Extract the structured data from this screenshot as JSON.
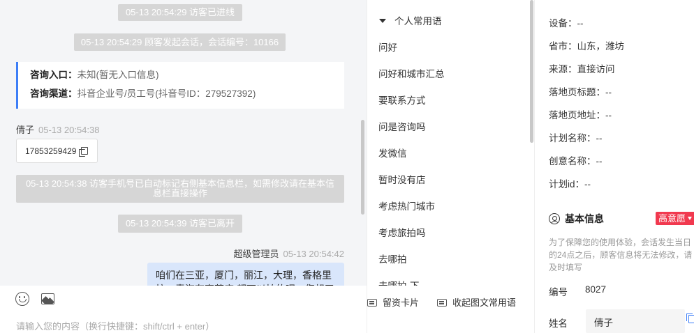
{
  "chat": {
    "sys_entered": "05-13 20:54:29 访客已进线",
    "sys_started": "05-13 20:54:29 顾客发起会话，会话编号：10166",
    "info_card": {
      "entry_label": "咨询入口：",
      "entry_value": "未知(暂无入口信息)",
      "channel_label": "咨询渠道：",
      "channel_value": "抖音企业号/员工号(抖音号ID：279527392)"
    },
    "visitor": {
      "name": "倩子",
      "time": "05-13 20:54:38"
    },
    "phone": "17853259429",
    "sys_phone_marked": "05-13 20:54:38 访客手机号已自动标记右侧基本信息栏，如需修改请在基本信息栏直接操作",
    "sys_left": "05-13 20:54:39 访客已离开",
    "agent": {
      "name": "超级管理员",
      "time": "05-13 20:54:42"
    },
    "agent_message": "咱们在三亚，厦门，丽江，大理，香格里拉，青海有直营店 都可以拍的呢，您想了解"
  },
  "composer": {
    "placeholder": "请输入您的内容（换行快捷键：shift/ctrl + enter）",
    "card_label": "留资卡片",
    "phrases_label": "收起图文常用语"
  },
  "phrases": {
    "group": "个人常用语",
    "items": [
      "问好",
      "问好和城市汇总",
      "要联系方式",
      "问是咨询吗",
      "发微信",
      "暂时没有店",
      "考虑热门城市",
      "考虑旅拍吗",
      "去哪拍",
      "去哪拍-下"
    ]
  },
  "info": {
    "device_label": "设备：",
    "device_value": "--",
    "province_label": "省市：",
    "province_value": "山东，潍坊",
    "source_label": "来源：",
    "source_value": "直接访问",
    "landing_title_label": "落地页标题：",
    "landing_title_value": "--",
    "landing_url_label": "落地页地址：",
    "landing_url_value": "--",
    "plan_name_label": "计划名称：",
    "plan_name_value": "--",
    "creative_label": "创意名称：",
    "creative_value": "--",
    "plan_id_label": "计划id：",
    "plan_id_value": "--",
    "basic_title": "基本信息",
    "intent_badge": "高意愿",
    "notice": "为了保障您的使用体验，会话发生当日的24点之后，顾客信息将无法修改，请及时填写",
    "id_label": "编号",
    "id_value": "8027",
    "name_label": "姓名",
    "name_value": "倩子"
  },
  "colors": {
    "accent": "#3d7ef7",
    "badge": "#f1394f",
    "bubble": "#d9e6fb",
    "system": "#d6d6d6"
  }
}
